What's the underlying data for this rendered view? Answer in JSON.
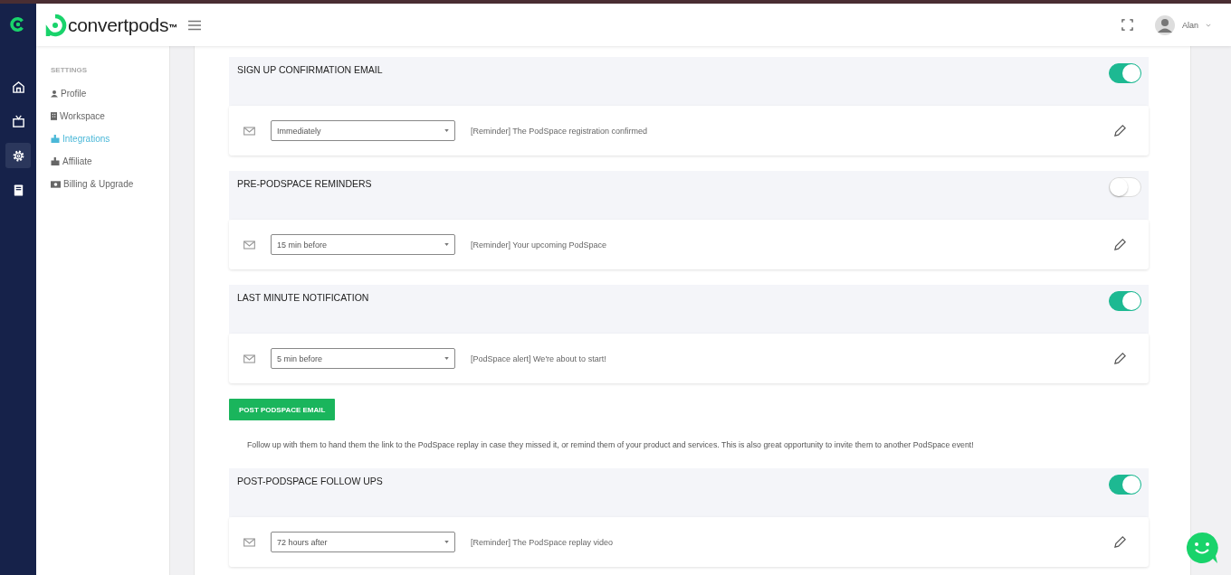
{
  "rail": {
    "items": [
      {
        "kind": "home",
        "selected": false
      },
      {
        "kind": "tv",
        "selected": false
      },
      {
        "kind": "settings",
        "selected": true
      },
      {
        "kind": "book",
        "selected": false
      }
    ]
  },
  "header": {
    "logo": "convertpods",
    "trademark": "™",
    "user": "Alan"
  },
  "sidebar": {
    "heading": "SETTINGS",
    "items": [
      {
        "label": "Profile",
        "kind": "user",
        "selected": false
      },
      {
        "label": "Workspace",
        "kind": "building",
        "selected": false
      },
      {
        "label": "Integrations",
        "kind": "puzzle",
        "selected": true
      },
      {
        "label": "Affiliate",
        "kind": "puzzle",
        "selected": false
      },
      {
        "label": "Billing & Upgrade",
        "kind": "money",
        "selected": false
      }
    ]
  },
  "sections": [
    {
      "title": "SIGN UP CONFIRMATION EMAIL",
      "on": true,
      "timing": "Immediately",
      "subject": "[Reminder] The PodSpace registration confirmed"
    },
    {
      "title": "PRE-PODSPACE REMINDERS",
      "on": false,
      "timing": "15 min before",
      "subject": "[Reminder] Your upcoming PodSpace"
    },
    {
      "title": "LAST MINUTE NOTIFICATION",
      "on": true,
      "timing": "5 min before",
      "subject": "[PodSpace alert] We're about to start!"
    }
  ],
  "post_podspace": {
    "button": "POST PODSPACE EMAIL",
    "description": "Follow up with them to hand them the link to the PodSpace replay in case they missed it, or remind them of your product and services. This is also great opportunity to invite them to another PodSpace event!",
    "sections": [
      {
        "title": "POST-PODSPACE FOLLOW UPS",
        "on": true,
        "timing": "72 hours after",
        "subject": "[Reminder] The PodSpace replay video"
      }
    ]
  }
}
